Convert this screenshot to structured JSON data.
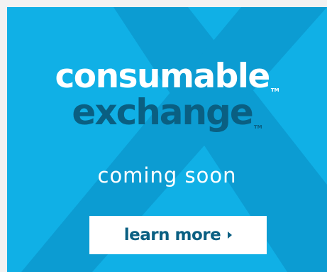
{
  "ad": {
    "headline_line1": "consumable",
    "headline_line2": "exchange",
    "trademark": "TM",
    "tagline": "coming soon",
    "cta_label": "learn more"
  },
  "colors": {
    "background": "#10b0e6",
    "x_shape": "#0c9cd2",
    "brand_dark": "#0a5f82",
    "white": "#ffffff"
  },
  "icons": {
    "cta_arrow": "caret-right-icon",
    "background_mark": "x-logo-mark"
  }
}
